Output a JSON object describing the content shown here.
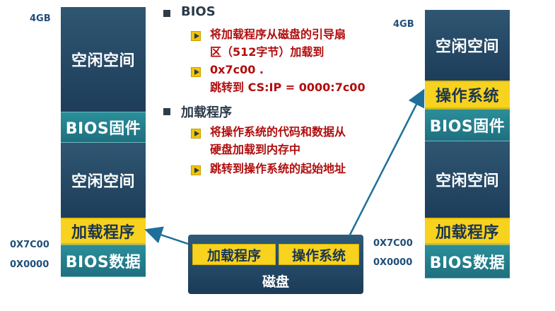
{
  "left_column": {
    "top_address": "4GB",
    "blocks": [
      "空闲空间",
      "BIOS固件",
      "空闲空间",
      "加载程序",
      "BIOS数据"
    ],
    "addr_loader": "0X7C00",
    "addr_zero": "0X0000"
  },
  "right_column": {
    "top_address": "4GB",
    "blocks": [
      "空闲空间",
      "操作系统",
      "BIOS固件",
      "空闲空间",
      "加载程序",
      "BIOS数据"
    ],
    "addr_loader": "0X7C00",
    "addr_zero": "0X0000"
  },
  "bios_section": {
    "heading": "BIOS",
    "item1_line1": "将加载程序从磁盘的引导扇",
    "item1_line2": "区（512字节）加载到",
    "item2_line1": "0x7c00 .",
    "item2_line2": "跳转到 CS:IP = 0000:7c00"
  },
  "loader_section": {
    "heading": "加载程序",
    "item1_line1": "将操作系统的代码和数据从",
    "item1_line2": "硬盘加载到内存中",
    "item2": "跳转到操作系统的起始地址"
  },
  "disk": {
    "loader": "加载程序",
    "os": "操作系统",
    "label": "磁盘"
  },
  "colors": {
    "free_space": "#1d3d5a",
    "firmware": "#1f6f7f",
    "highlight": "#f7d21e",
    "text_red": "#b10d0d",
    "arrow": "#1f6f9a"
  }
}
